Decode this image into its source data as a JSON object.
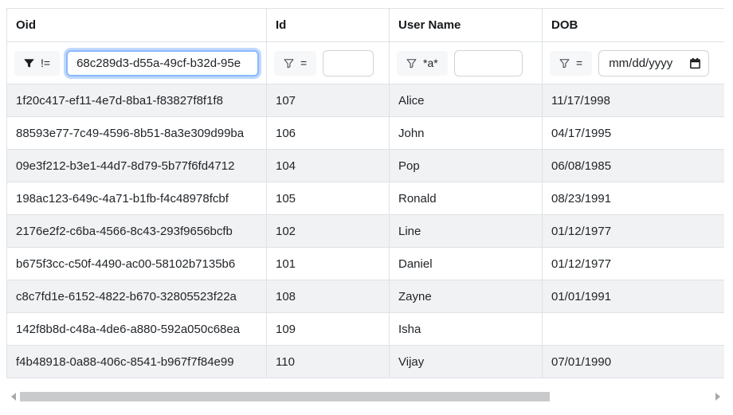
{
  "grid": {
    "columns": [
      {
        "label": "Oid",
        "filter": {
          "operator": "!=",
          "icon": "funnel-filled-icon",
          "value": "68c289d3-d55a-49cf-b32d-95e",
          "focused": true
        }
      },
      {
        "label": "Id",
        "filter": {
          "operator": "=",
          "icon": "funnel-outline-icon",
          "value": ""
        }
      },
      {
        "label": "User Name",
        "filter": {
          "operator": "*a*",
          "icon": "funnel-outline-icon",
          "value": ""
        }
      },
      {
        "label": "DOB",
        "filter": {
          "operator": "=",
          "icon": "funnel-outline-icon",
          "value": "",
          "placeholder": "mm/dd/yyyy",
          "calendar_icon": "calendar-icon"
        }
      }
    ],
    "rows": [
      {
        "oid": "1f20c417-ef11-4e7d-8ba1-f83827f8f1f8",
        "id": "107",
        "user_name": "Alice",
        "dob": "11/17/1998"
      },
      {
        "oid": "88593e77-7c49-4596-8b51-8a3e309d99ba",
        "id": "106",
        "user_name": "John",
        "dob": "04/17/1995"
      },
      {
        "oid": "09e3f212-b3e1-44d7-8d79-5b77f6fd4712",
        "id": "104",
        "user_name": "Pop",
        "dob": "06/08/1985"
      },
      {
        "oid": "198ac123-649c-4a71-b1fb-f4c48978fcbf",
        "id": "105",
        "user_name": "Ronald",
        "dob": "08/23/1991"
      },
      {
        "oid": "2176e2f2-c6ba-4566-8c43-293f9656bcfb",
        "id": "102",
        "user_name": "Line",
        "dob": "01/12/1977"
      },
      {
        "oid": "b675f3cc-c50f-4490-ac00-58102b7135b6",
        "id": "101",
        "user_name": "Daniel",
        "dob": "01/12/1977"
      },
      {
        "oid": "c8c7fd1e-6152-4822-b670-32805523f22a",
        "id": "108",
        "user_name": "Zayne",
        "dob": "01/01/1991"
      },
      {
        "oid": "142f8b8d-c48a-4de6-a880-592a050c68ea",
        "id": "109",
        "user_name": "Isha",
        "dob": ""
      },
      {
        "oid": "f4b48918-0a88-406c-8541-b967f7f84e99",
        "id": "110",
        "user_name": "Vijay",
        "dob": "07/01/1990"
      }
    ]
  },
  "colors": {
    "row_stripe": "#f1f2f3",
    "border": "#dee2e6",
    "filter_button_bg": "#f6f7f8",
    "focus_ring": "#8bb9fe",
    "scroll_thumb": "#c9cacb",
    "text": "#212529"
  }
}
